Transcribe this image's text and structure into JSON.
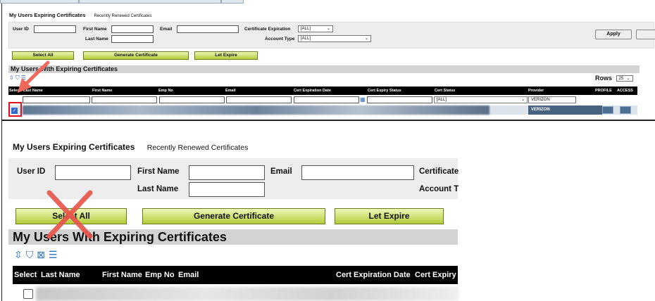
{
  "top_panel": {
    "tabs": {
      "active": "My Users Expiring Certificates",
      "inactive": "Recently Renewed Certificates"
    },
    "filters": {
      "user_id": "User ID",
      "first_name": "First Name",
      "last_name": "Last Name",
      "email": "Email",
      "cert_expiration": "Certificate Expiration",
      "cert_expiration_value": "[ALL]",
      "account_type": "Account Type",
      "account_type_value": "[ALL]",
      "apply": "Apply"
    },
    "buttons": {
      "select_all": "Select All",
      "generate": "Generate Certificate",
      "let_expire": "Let Expire"
    },
    "section_title": "My Users With Expiring Certificates",
    "rows_label": "Rows",
    "rows_value": "25",
    "columns": [
      "Select",
      "Last Name",
      "First Name",
      "Emp No",
      "Email",
      "Cert Expiration Date",
      "Cert Expiry Status",
      "Cert Status",
      "Provider",
      "PROFILE",
      "ACCESS"
    ],
    "filter_row": {
      "cert_status_value": "[ALL]",
      "provider_value": "VERIZON"
    },
    "data_row": {
      "checked": true,
      "provider": "VERIZON"
    }
  },
  "bottom_panel": {
    "tabs": {
      "active": "My Users Expiring Certificates",
      "inactive": "Recently Renewed Certificates"
    },
    "filters": {
      "user_id": "User ID",
      "first_name": "First Name",
      "last_name": "Last Name",
      "email": "Email",
      "cert_expiration_partial": "Certificate",
      "account_type_partial": "Account T"
    },
    "buttons": {
      "select_all": "Select All",
      "generate": "Generate Certificate",
      "let_expire": "Let Expire"
    },
    "section_title": "My Users With Expiring Certificates",
    "columns": [
      "Select",
      "Last Name",
      "First Name",
      "Emp No",
      "Email",
      "Cert Expiration Date",
      "Cert Expiry"
    ],
    "data_row": {
      "checked": false
    }
  },
  "annotation_colors": {
    "highlight": "#e3111d",
    "arrow": "#f2685a",
    "cross": "#e8534a"
  }
}
